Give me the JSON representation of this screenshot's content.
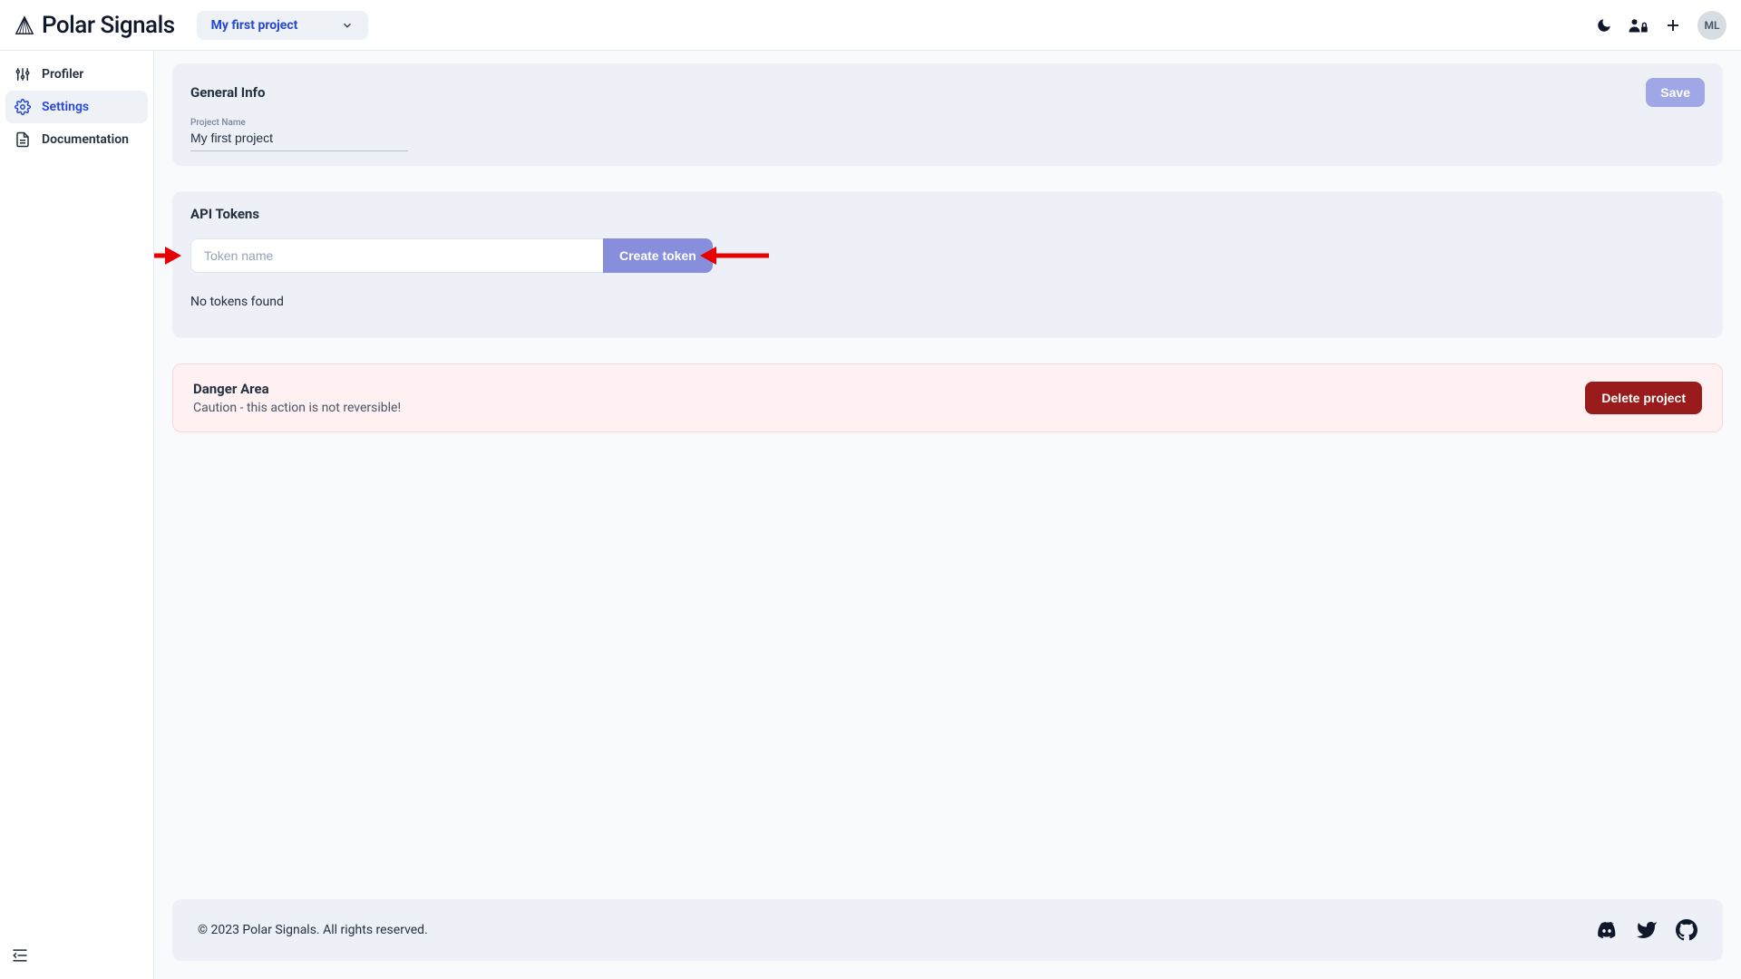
{
  "brand": "Polar Signals",
  "project": {
    "selected": "My first project"
  },
  "user": {
    "initials": "ML"
  },
  "sidebar": {
    "items": [
      {
        "label": "Profiler"
      },
      {
        "label": "Settings"
      },
      {
        "label": "Documentation"
      }
    ]
  },
  "general": {
    "title": "General Info",
    "field_label": "Project Name",
    "project_name": "My first project",
    "save_label": "Save"
  },
  "tokens": {
    "title": "API Tokens",
    "placeholder": "Token name",
    "create_label": "Create token",
    "empty_text": "No tokens found"
  },
  "danger": {
    "title": "Danger Area",
    "subtitle": "Caution - this action is not reversible!",
    "delete_label": "Delete project"
  },
  "footer": {
    "copyright": "© 2023 Polar Signals. All rights reserved."
  }
}
